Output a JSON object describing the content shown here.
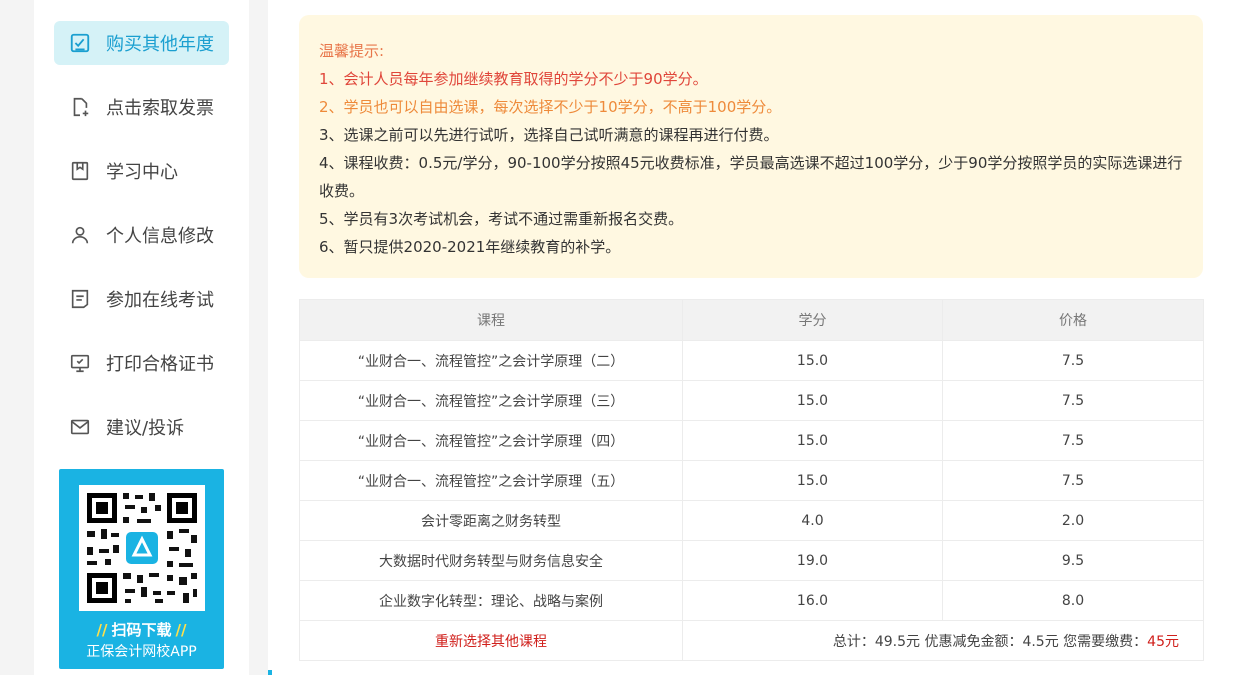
{
  "sidebar": {
    "items": [
      {
        "label": "购买其他年度",
        "icon": "checkbox-icon",
        "active": true
      },
      {
        "label": "点击索取发票",
        "icon": "document-add-icon",
        "active": false
      },
      {
        "label": "学习中心",
        "icon": "bookmark-icon",
        "active": false
      },
      {
        "label": "个人信息修改",
        "icon": "user-icon",
        "active": false
      },
      {
        "label": "参加在线考试",
        "icon": "exam-icon",
        "active": false
      },
      {
        "label": "打印合格证书",
        "icon": "monitor-icon",
        "active": false
      },
      {
        "label": "建议/投诉",
        "icon": "mail-icon",
        "active": false
      }
    ],
    "qr": {
      "caption": "扫码下载",
      "app_name": "正保会计网校APP"
    }
  },
  "notice": {
    "title": "温馨提示:",
    "lines": [
      "1、会计人员每年参加继续教育取得的学分不少于90学分。",
      "2、学员也可以自由选课，每次选择不少于10学分，不高于100学分。",
      "3、选课之前可以先进行试听，选择自己试听满意的课程再进行付费。",
      "4、课程收费：0.5元/学分，90-100学分按照45元收费标准，学员最高选课不超过100学分，少于90学分按照学员的实际选课进行收费。",
      "5、学员有3次考试机会，考试不通过需重新报名交费。",
      "6、暂只提供2020-2021年继续教育的补学。"
    ]
  },
  "table": {
    "headers": [
      "课程",
      "学分",
      "价格"
    ],
    "rows": [
      {
        "course": "“业财合一、流程管控”之会计学原理（二）",
        "credit": "15.0",
        "price": "7.5"
      },
      {
        "course": "“业财合一、流程管控”之会计学原理（三）",
        "credit": "15.0",
        "price": "7.5"
      },
      {
        "course": "“业财合一、流程管控”之会计学原理（四）",
        "credit": "15.0",
        "price": "7.5"
      },
      {
        "course": "“业财合一、流程管控”之会计学原理（五）",
        "credit": "15.0",
        "price": "7.5"
      },
      {
        "course": "会计零距离之财务转型",
        "credit": "4.0",
        "price": "2.0"
      },
      {
        "course": "大数据时代财务转型与财务信息安全",
        "credit": "19.0",
        "price": "9.5"
      },
      {
        "course": "企业数字化转型：理论、战略与案例",
        "credit": "16.0",
        "price": "8.0"
      }
    ],
    "reselect_label": "重新选择其他课程",
    "summary_text": "总计：49.5元 优惠减免金额：4.5元 您需要缴费：",
    "final_amount": "45元"
  },
  "colors": {
    "accent": "#1ab3e3",
    "active_bg": "#d5f2f7",
    "warning": "#e0463a",
    "orange": "#ee8a3a",
    "notice_bg": "#fff8e1"
  }
}
